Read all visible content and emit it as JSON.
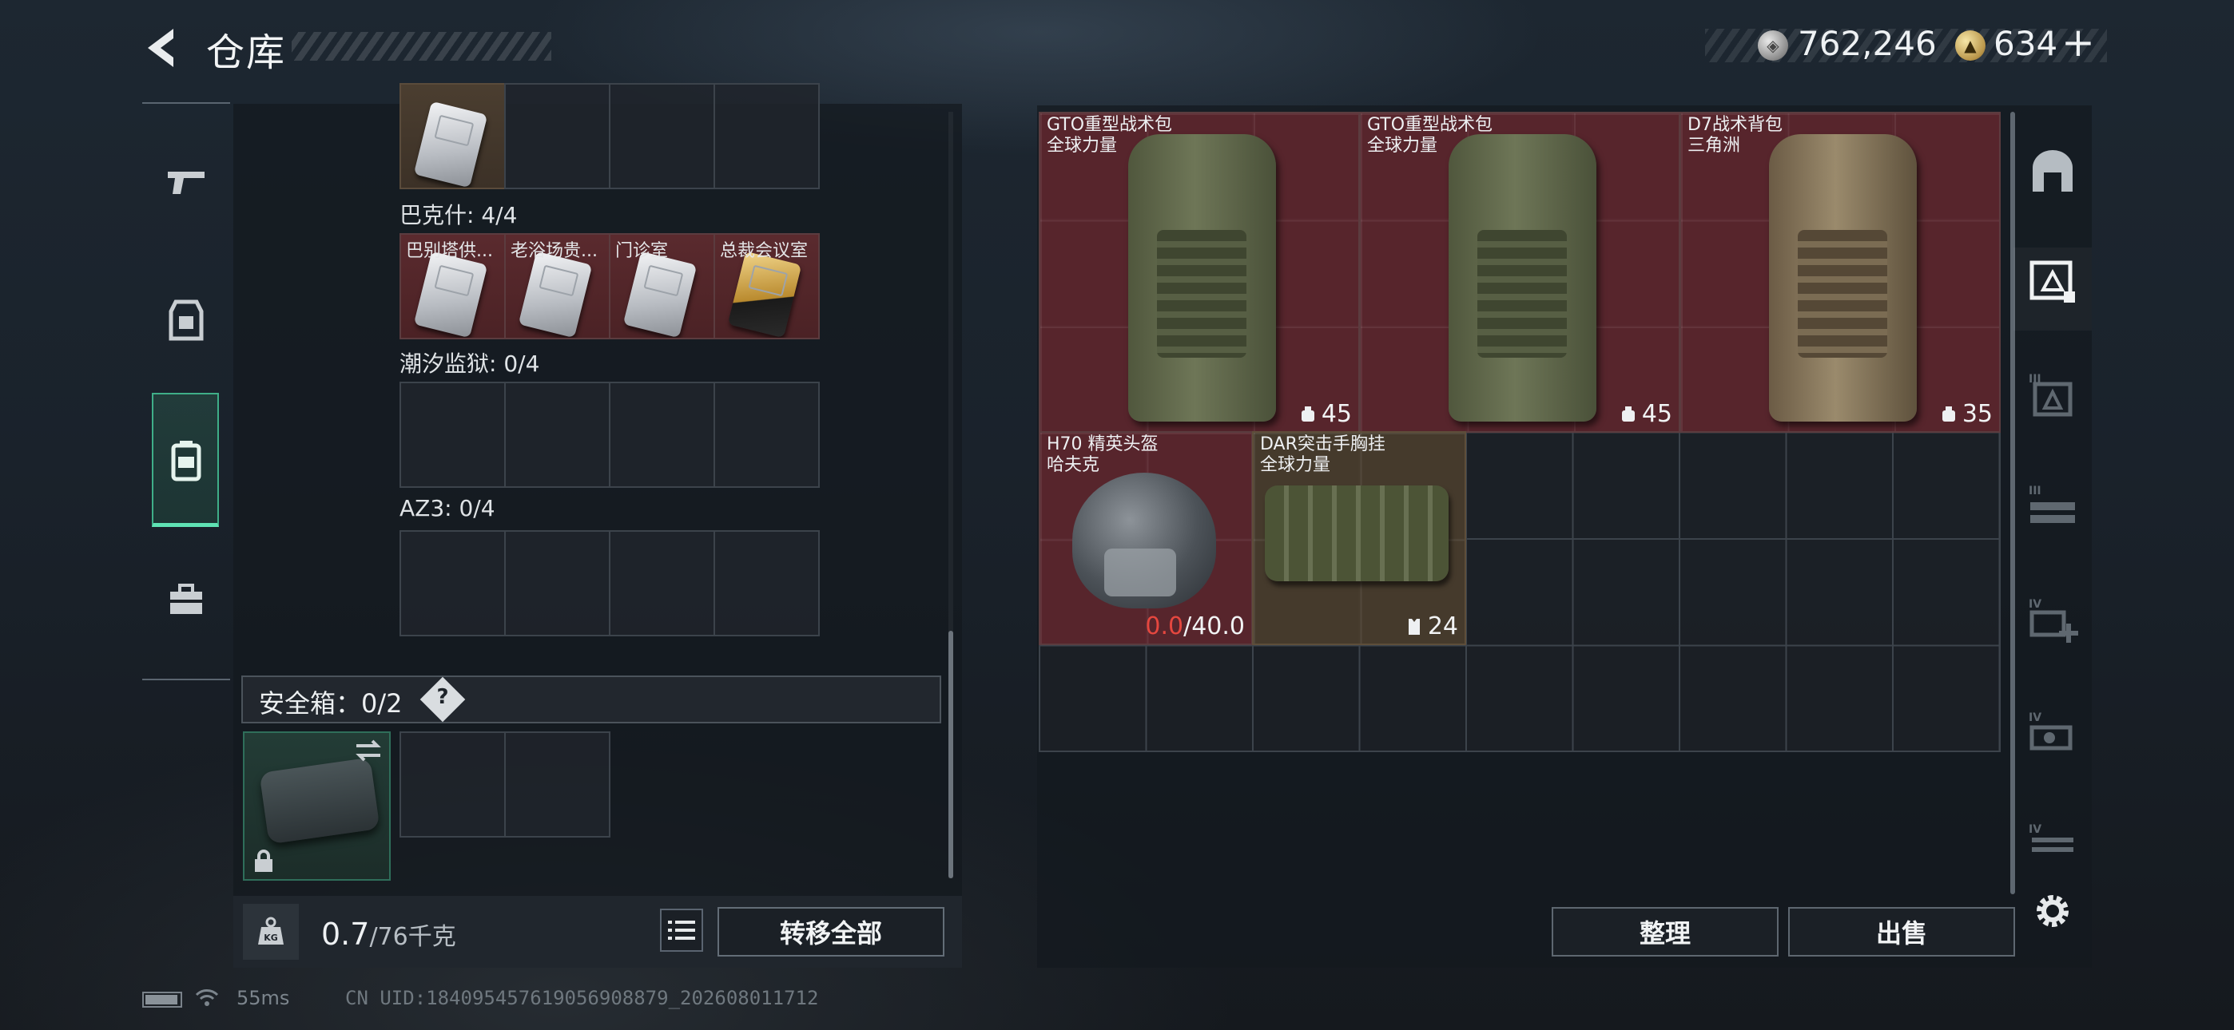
{
  "header": {
    "title": "仓库",
    "currencies": [
      {
        "icon": "silver-coin-icon",
        "value": "762,246"
      },
      {
        "icon": "gold-coin-icon",
        "value": "634"
      }
    ],
    "add_label": "+"
  },
  "left_panel": {
    "top_partial_row": {
      "items": [
        {
          "type": "keycard"
        }
      ]
    },
    "sections": [
      {
        "label": "巴克什: 4/4",
        "items": [
          {
            "name": "巴别塔供...",
            "style": "silver"
          },
          {
            "name": "老浴场贵...",
            "style": "silver"
          },
          {
            "name": "门诊室",
            "style": "silver"
          },
          {
            "name": "总裁会议室",
            "style": "gold"
          }
        ]
      },
      {
        "label": "潮汐监狱: 0/4",
        "items": []
      },
      {
        "label": "AZ3: 0/4",
        "items": []
      }
    ],
    "safe_box": {
      "label": "安全箱：0/2",
      "help": "?"
    },
    "weight": {
      "current": "0.7",
      "max": "/76千克"
    },
    "transfer_all_label": "转移全部"
  },
  "right_panel": {
    "items": [
      {
        "name": "GTO重型战术包",
        "sub": "全球力量",
        "value": "45",
        "value_icon": "capacity-icon",
        "color": "red"
      },
      {
        "name": "GTO重型战术包",
        "sub": "全球力量",
        "value": "45",
        "value_icon": "capacity-icon",
        "color": "red"
      },
      {
        "name": "D7战术背包",
        "sub": "三角洲",
        "value": "35",
        "value_icon": "capacity-icon",
        "color": "red"
      },
      {
        "name": "H70 精英头盔",
        "sub": "哈夫克",
        "durability_current": "0.0",
        "durability_max": "/40.0",
        "color": "red"
      },
      {
        "name": "DAR突击手胸挂",
        "sub": "全球力量",
        "value": "24",
        "value_icon": "vest-capacity-icon",
        "color": "tan"
      }
    ],
    "sort_label": "整理",
    "sell_label": "出售"
  },
  "status_bar": {
    "ping": "55ms",
    "uid": "CN UID:18409545761905690887​9_202608011712"
  }
}
